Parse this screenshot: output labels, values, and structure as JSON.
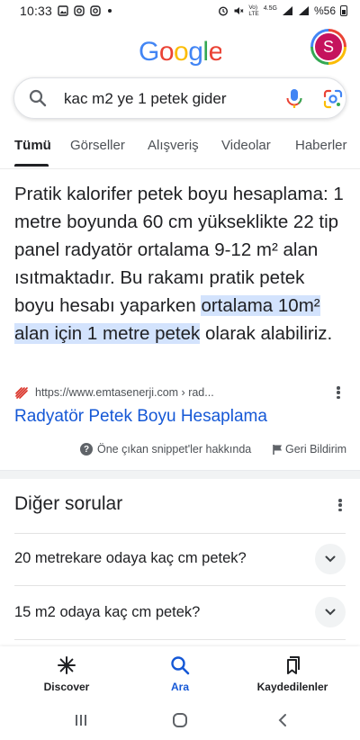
{
  "status_bar": {
    "time": "10:33",
    "network_top": "Vo)",
    "network_bottom": "LTE",
    "signal_gen": "4.5G",
    "battery": "%56"
  },
  "header": {
    "logo_text": "Google",
    "avatar_initial": "S",
    "colors": {
      "blue": "#4285F4",
      "red": "#EA4335",
      "yellow": "#FBBC05",
      "green": "#34A853",
      "avatar_bg": "#C5135D"
    }
  },
  "search": {
    "query": "kac m2 ye 1 petek gider"
  },
  "tabs": [
    "Tümü",
    "Görseller",
    "Alışveriş",
    "Videolar",
    "Haberler"
  ],
  "snippet": {
    "text_before": "Pratik kalorifer petek boyu hesaplama: 1 metre boyunda 60 cm yükseklikte 22 tip panel radyatör ortalama 9-12 m² alan ısıtmaktadır. Bu rakamı pratik petek boyu hesabı yaparken ",
    "text_highlight": "ortalama 10m² alan için 1 metre petek",
    "text_after": " olarak alabiliriz.",
    "source_url": "https://www.emtasenerji.com › rad...",
    "link_title": "Radyatör Petek Boyu Hesaplama",
    "about_label": "Öne çıkan snippet'ler hakkında",
    "feedback_label": "Geri Bildirim",
    "highlight_color": "#D3E3FD",
    "link_color": "#1558D6"
  },
  "paa": {
    "title": "Diğer sorular",
    "questions": [
      "20 metrekare odaya kaç cm petek?",
      "15 m2 odaya kaç cm petek?"
    ]
  },
  "bottom_nav": {
    "items": [
      "Discover",
      "Ara",
      "Kaydedilenler"
    ],
    "active": "Ara"
  }
}
